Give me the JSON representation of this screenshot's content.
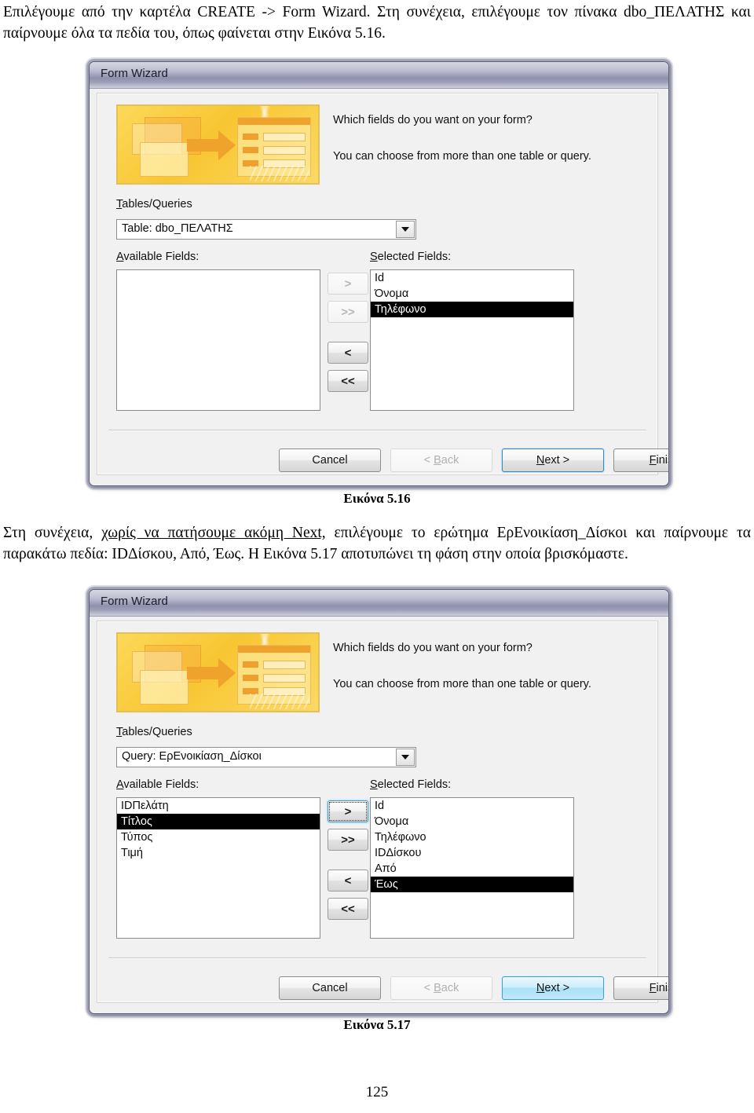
{
  "document": {
    "paragraph_top_html": "Επιλέγουμε από την καρτέλα CREATE -&gt; Form Wizard. Στη συνέχεια, επιλέγουμε τον πίνακα dbo_ΠΕΛΑΤΗΣ και παίρνουμε όλα τα πεδία του, όπως φαίνεται στην Εικόνα 5.16.",
    "paragraph_mid_lead": "Στη συνέχεια, ",
    "paragraph_mid_underlined": "χωρίς να πατήσουμε ακόμη Next,",
    "paragraph_mid_rest": " επιλέγουμε το ερώτημα ΕρΕνοικίαση_Δίσκοι και παίρνουμε τα παρακάτω πεδία: IDΔίσκου, Από, Έως. Η Εικόνα 5.17 αποτυπώνει τη φάση στην οποία βρισκόμαστε.",
    "caption_1": "Εικόνα 5.16",
    "caption_2": "Εικόνα 5.17",
    "page_number": "125"
  },
  "colors": {
    "titlebar_top": "#d9d9e4",
    "titlebar_mid": "#8f90ab",
    "banner_gold": "#f8c632",
    "banner_accent": "#f0a32c",
    "selection": "#000000",
    "default_button_border": "#3c88ae",
    "hot_button_fill": "#a9e0f7"
  },
  "dialog1": {
    "title": "Form Wizard",
    "banner_icon": "tables-to-form-banner",
    "prompt_1": "Which fields do you want on your form?",
    "prompt_2": "You can choose from more than one table or query.",
    "tables_queries_label": "Tables/Queries",
    "tables_queries_accel": "T",
    "combo_value": "Table: dbo_ΠΕΛΑΤΗΣ",
    "available_label": "Available Fields:",
    "available_accel": "A",
    "available_fields": [],
    "selected_label": "Selected Fields:",
    "selected_accel": "S",
    "selected_fields": [
      {
        "label": "Id",
        "selected": false
      },
      {
        "label": "Όνομα",
        "selected": false
      },
      {
        "label": "Τηλέφωνο",
        "selected": true
      }
    ],
    "move_buttons": [
      {
        "label": ">",
        "name": "move-right-button",
        "state": "disabled"
      },
      {
        "label": ">>",
        "name": "move-all-right-button",
        "state": "disabled"
      },
      {
        "label": "<",
        "name": "move-left-button",
        "state": "enabled"
      },
      {
        "label": "<<",
        "name": "move-all-left-button",
        "state": "enabled"
      }
    ],
    "footer_buttons": [
      {
        "label": "Cancel",
        "name": "cancel-button",
        "state": "enabled",
        "accel": ""
      },
      {
        "label": "< Back",
        "name": "back-button",
        "state": "disabled",
        "accel": "B"
      },
      {
        "label": "Next >",
        "name": "next-button",
        "state": "default",
        "accel": "N"
      },
      {
        "label": "Finish",
        "name": "finish-button",
        "state": "enabled",
        "accel": "F"
      }
    ]
  },
  "dialog2": {
    "title": "Form Wizard",
    "banner_icon": "tables-to-form-banner",
    "prompt_1": "Which fields do you want on your form?",
    "prompt_2": "You can choose from more than one table or query.",
    "tables_queries_label": "Tables/Queries",
    "tables_queries_accel": "T",
    "combo_value": "Query: ΕρΕνοικίαση_Δίσκοι",
    "available_label": "Available Fields:",
    "available_accel": "A",
    "available_fields": [
      {
        "label": "IDΠελάτη",
        "selected": false
      },
      {
        "label": "Τίτλος",
        "selected": true
      },
      {
        "label": "Τύπος",
        "selected": false
      },
      {
        "label": "Τιμή",
        "selected": false
      }
    ],
    "selected_label": "Selected Fields:",
    "selected_accel": "S",
    "selected_fields": [
      {
        "label": "Id",
        "selected": false
      },
      {
        "label": "Όνομα",
        "selected": false
      },
      {
        "label": "Τηλέφωνο",
        "selected": false
      },
      {
        "label": "IDΔίσκου",
        "selected": false
      },
      {
        "label": "Από",
        "selected": false
      },
      {
        "label": "Έως",
        "selected": true
      }
    ],
    "move_buttons": [
      {
        "label": ">",
        "name": "move-right-button",
        "state": "focused"
      },
      {
        "label": ">>",
        "name": "move-all-right-button",
        "state": "enabled"
      },
      {
        "label": "<",
        "name": "move-left-button",
        "state": "enabled"
      },
      {
        "label": "<<",
        "name": "move-all-left-button",
        "state": "enabled"
      }
    ],
    "footer_buttons": [
      {
        "label": "Cancel",
        "name": "cancel-button",
        "state": "enabled",
        "accel": ""
      },
      {
        "label": "< Back",
        "name": "back-button",
        "state": "disabled",
        "accel": "B"
      },
      {
        "label": "Next >",
        "name": "next-button",
        "state": "hot",
        "accel": "N"
      },
      {
        "label": "Finish",
        "name": "finish-button",
        "state": "enabled",
        "accel": "F"
      }
    ]
  }
}
